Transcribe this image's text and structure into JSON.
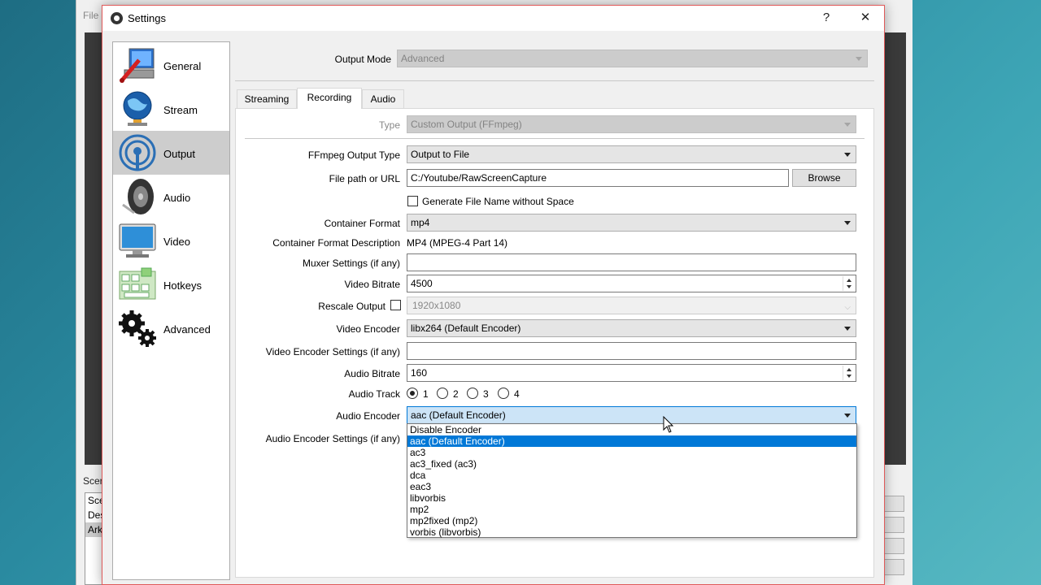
{
  "background_app": {
    "menu_file": "File",
    "scenes_label": "Scer",
    "scenes": [
      "Sce",
      "Des",
      "Ark"
    ]
  },
  "dialog": {
    "title": "Settings",
    "help_button": "?",
    "close_button": "✕"
  },
  "categories": [
    {
      "label": "General",
      "icon": "general-icon"
    },
    {
      "label": "Stream",
      "icon": "stream-globe-icon"
    },
    {
      "label": "Output",
      "icon": "output-broadcast-icon",
      "selected": true
    },
    {
      "label": "Audio",
      "icon": "audio-speaker-icon"
    },
    {
      "label": "Video",
      "icon": "video-monitor-icon"
    },
    {
      "label": "Hotkeys",
      "icon": "hotkeys-keyboard-icon"
    },
    {
      "label": "Advanced",
      "icon": "advanced-gears-icon"
    }
  ],
  "output_mode": {
    "label": "Output Mode",
    "value": "Advanced"
  },
  "tabs": [
    {
      "label": "Streaming"
    },
    {
      "label": "Recording",
      "selected": true
    },
    {
      "label": "Audio"
    }
  ],
  "recording": {
    "type": {
      "label": "Type",
      "value": "Custom Output (FFmpeg)"
    },
    "ffmpeg_output_type": {
      "label": "FFmpeg Output Type",
      "value": "Output to File"
    },
    "file_path": {
      "label": "File path or URL",
      "value": "C:/Youtube/RawScreenCapture",
      "browse": "Browse"
    },
    "generate_name": {
      "label": "Generate File Name without Space",
      "checked": false
    },
    "container_format": {
      "label": "Container Format",
      "value": "mp4"
    },
    "container_desc": {
      "label": "Container Format Description",
      "value": "MP4 (MPEG-4 Part 14)"
    },
    "muxer_settings": {
      "label": "Muxer Settings (if any)",
      "value": ""
    },
    "video_bitrate": {
      "label": "Video Bitrate",
      "value": "4500"
    },
    "rescale_output": {
      "label": "Rescale Output",
      "checked": false,
      "value": "1920x1080"
    },
    "video_encoder": {
      "label": "Video Encoder",
      "value": "libx264 (Default Encoder)"
    },
    "video_encoder_settings": {
      "label": "Video Encoder Settings (if any)",
      "value": ""
    },
    "audio_bitrate": {
      "label": "Audio Bitrate",
      "value": "160"
    },
    "audio_track": {
      "label": "Audio Track",
      "options": [
        "1",
        "2",
        "3",
        "4"
      ],
      "selected": "1"
    },
    "audio_encoder": {
      "label": "Audio Encoder",
      "value": "aac (Default Encoder)"
    },
    "audio_encoder_settings": {
      "label": "Audio Encoder Settings (if any)"
    }
  },
  "audio_encoder_dropdown": {
    "options": [
      "Disable Encoder",
      "aac (Default Encoder)",
      "ac3",
      "ac3_fixed (ac3)",
      "dca",
      "eac3",
      "libvorbis",
      "mp2",
      "mp2fixed (mp2)",
      "vorbis (libvorbis)"
    ],
    "highlighted": "aac (Default Encoder)"
  },
  "colors": {
    "highlight": "#0078d7",
    "dialog_border": "#e05a5a",
    "desktop": "#2a8aa0"
  }
}
